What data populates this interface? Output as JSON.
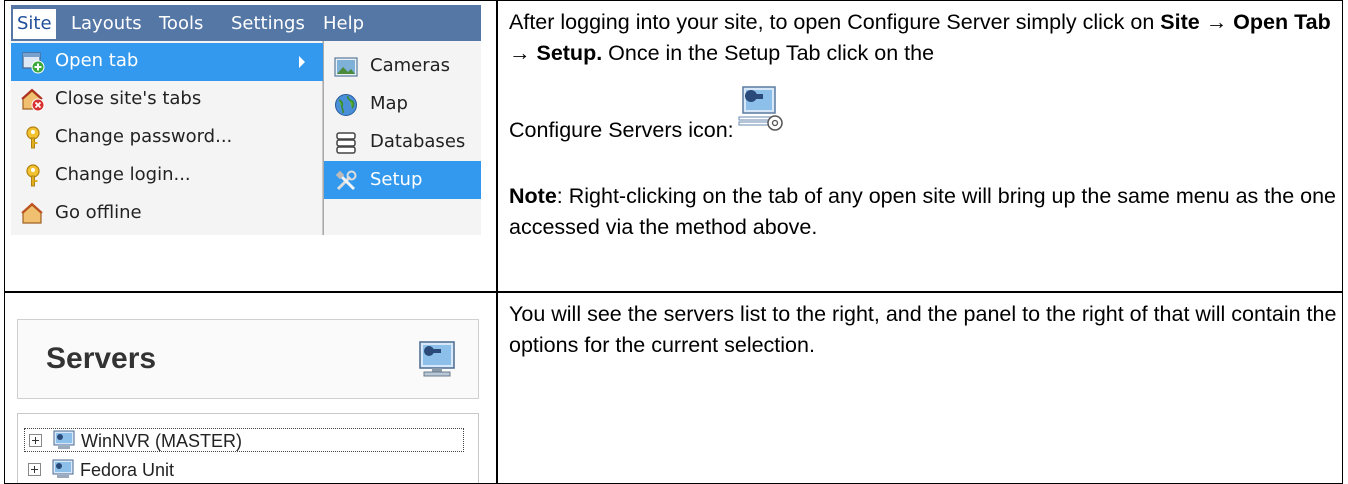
{
  "menu": {
    "menubar": [
      "Site",
      "Layouts",
      "Tools",
      "Settings",
      "Help"
    ],
    "items": [
      {
        "label": "Open tab",
        "icon": "open-tab-icon",
        "highlighted": true
      },
      {
        "label": "Close site's tabs",
        "icon": "close-site-icon"
      },
      {
        "label": "Change password...",
        "icon": "key-icon"
      },
      {
        "label": "Change login...",
        "icon": "key-icon"
      },
      {
        "label": "Go offline",
        "icon": "offline-icon"
      }
    ],
    "submenu": [
      {
        "label": "Cameras",
        "icon": "camera-icon"
      },
      {
        "label": "Map",
        "icon": "globe-icon"
      },
      {
        "label": "Databases",
        "icon": "database-icon"
      },
      {
        "label": "Setup",
        "icon": "tools-icon",
        "highlighted": true
      }
    ]
  },
  "row1": {
    "text_a": "After logging into your site, to open Configure Server simply click on ",
    "bold_path": "Site → Open Tab → Setup.",
    "text_b": " Once in the Setup Tab click on the",
    "icon_text": "Configure Servers icon:",
    "note_label": "Note",
    "note_text": ": Right-clicking on the tab of any open site will bring up the same menu as the one accessed via the method above."
  },
  "row2": {
    "text": "You will see the servers list to the right, and the panel to the right of that will contain the options for the current selection."
  },
  "servers": {
    "title": "Servers",
    "tree": [
      "WinNVR (MASTER)",
      "Fedora Unit"
    ]
  },
  "colors": {
    "menubar": "#5577a6",
    "highlight": "#3399ee"
  }
}
